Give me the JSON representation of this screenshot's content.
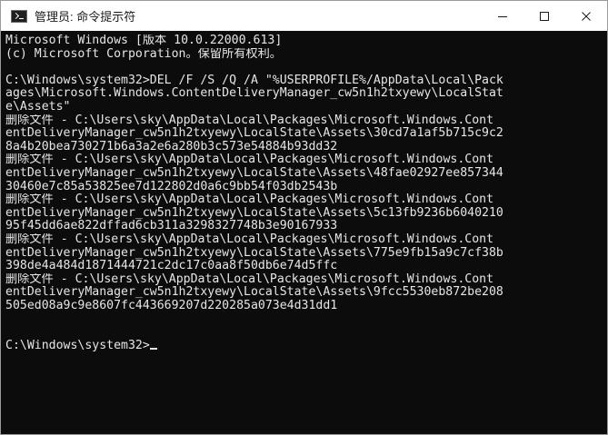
{
  "window": {
    "title": "管理员: 命令提示符",
    "app_icon": "cmd-icon",
    "controls": {
      "minimize_icon": "minimize-icon",
      "maximize_icon": "maximize-icon",
      "close_icon": "close-icon"
    }
  },
  "colors": {
    "console_background": "#0c0c0c",
    "console_text": "#e6e6e6",
    "titlebar_background": "#ffffff"
  },
  "console": {
    "lines": [
      "Microsoft Windows [版本 10.0.22000.613]",
      "(c) Microsoft Corporation。保留所有权利。",
      "",
      "C:\\Windows\\system32>DEL /F /S /Q /A \"%USERPROFILE%/AppData\\Local\\Pack",
      "ages\\Microsoft.Windows.ContentDeliveryManager_cw5n1h2txyewy\\LocalStat",
      "e\\Assets\"",
      "删除文件 - C:\\Users\\sky\\AppData\\Local\\Packages\\Microsoft.Windows.Cont",
      "entDeliveryManager_cw5n1h2txyewy\\LocalState\\Assets\\30cd7a1af5b715c9c2",
      "8a4b20bea730271b6a3a2e6a280b3c573e54884b93dd32",
      "删除文件 - C:\\Users\\sky\\AppData\\Local\\Packages\\Microsoft.Windows.Cont",
      "entDeliveryManager_cw5n1h2txyewy\\LocalState\\Assets\\48fae02927ee857344",
      "30460e7c85a53825ee7d122802d0a6c9bb54f03db2543b",
      "删除文件 - C:\\Users\\sky\\AppData\\Local\\Packages\\Microsoft.Windows.Cont",
      "entDeliveryManager_cw5n1h2txyewy\\LocalState\\Assets\\5c13fb9236b6040210",
      "95f45dd6ae822dffad6cb311a3298327748b3e90167933",
      "删除文件 - C:\\Users\\sky\\AppData\\Local\\Packages\\Microsoft.Windows.Cont",
      "entDeliveryManager_cw5n1h2txyewy\\LocalState\\Assets\\775e9fb15a9c7cf38b",
      "398de4a484d1871444721c2dc17c0aa8f50db6e74d5ffc",
      "删除文件 - C:\\Users\\sky\\AppData\\Local\\Packages\\Microsoft.Windows.Cont",
      "entDeliveryManager_cw5n1h2txyewy\\LocalState\\Assets\\9fcc5530eb872be208",
      "505ed08a9c9e8607fc443669207d220285a073e4d31dd1",
      "",
      ""
    ],
    "prompt": "C:\\Windows\\system32>"
  }
}
